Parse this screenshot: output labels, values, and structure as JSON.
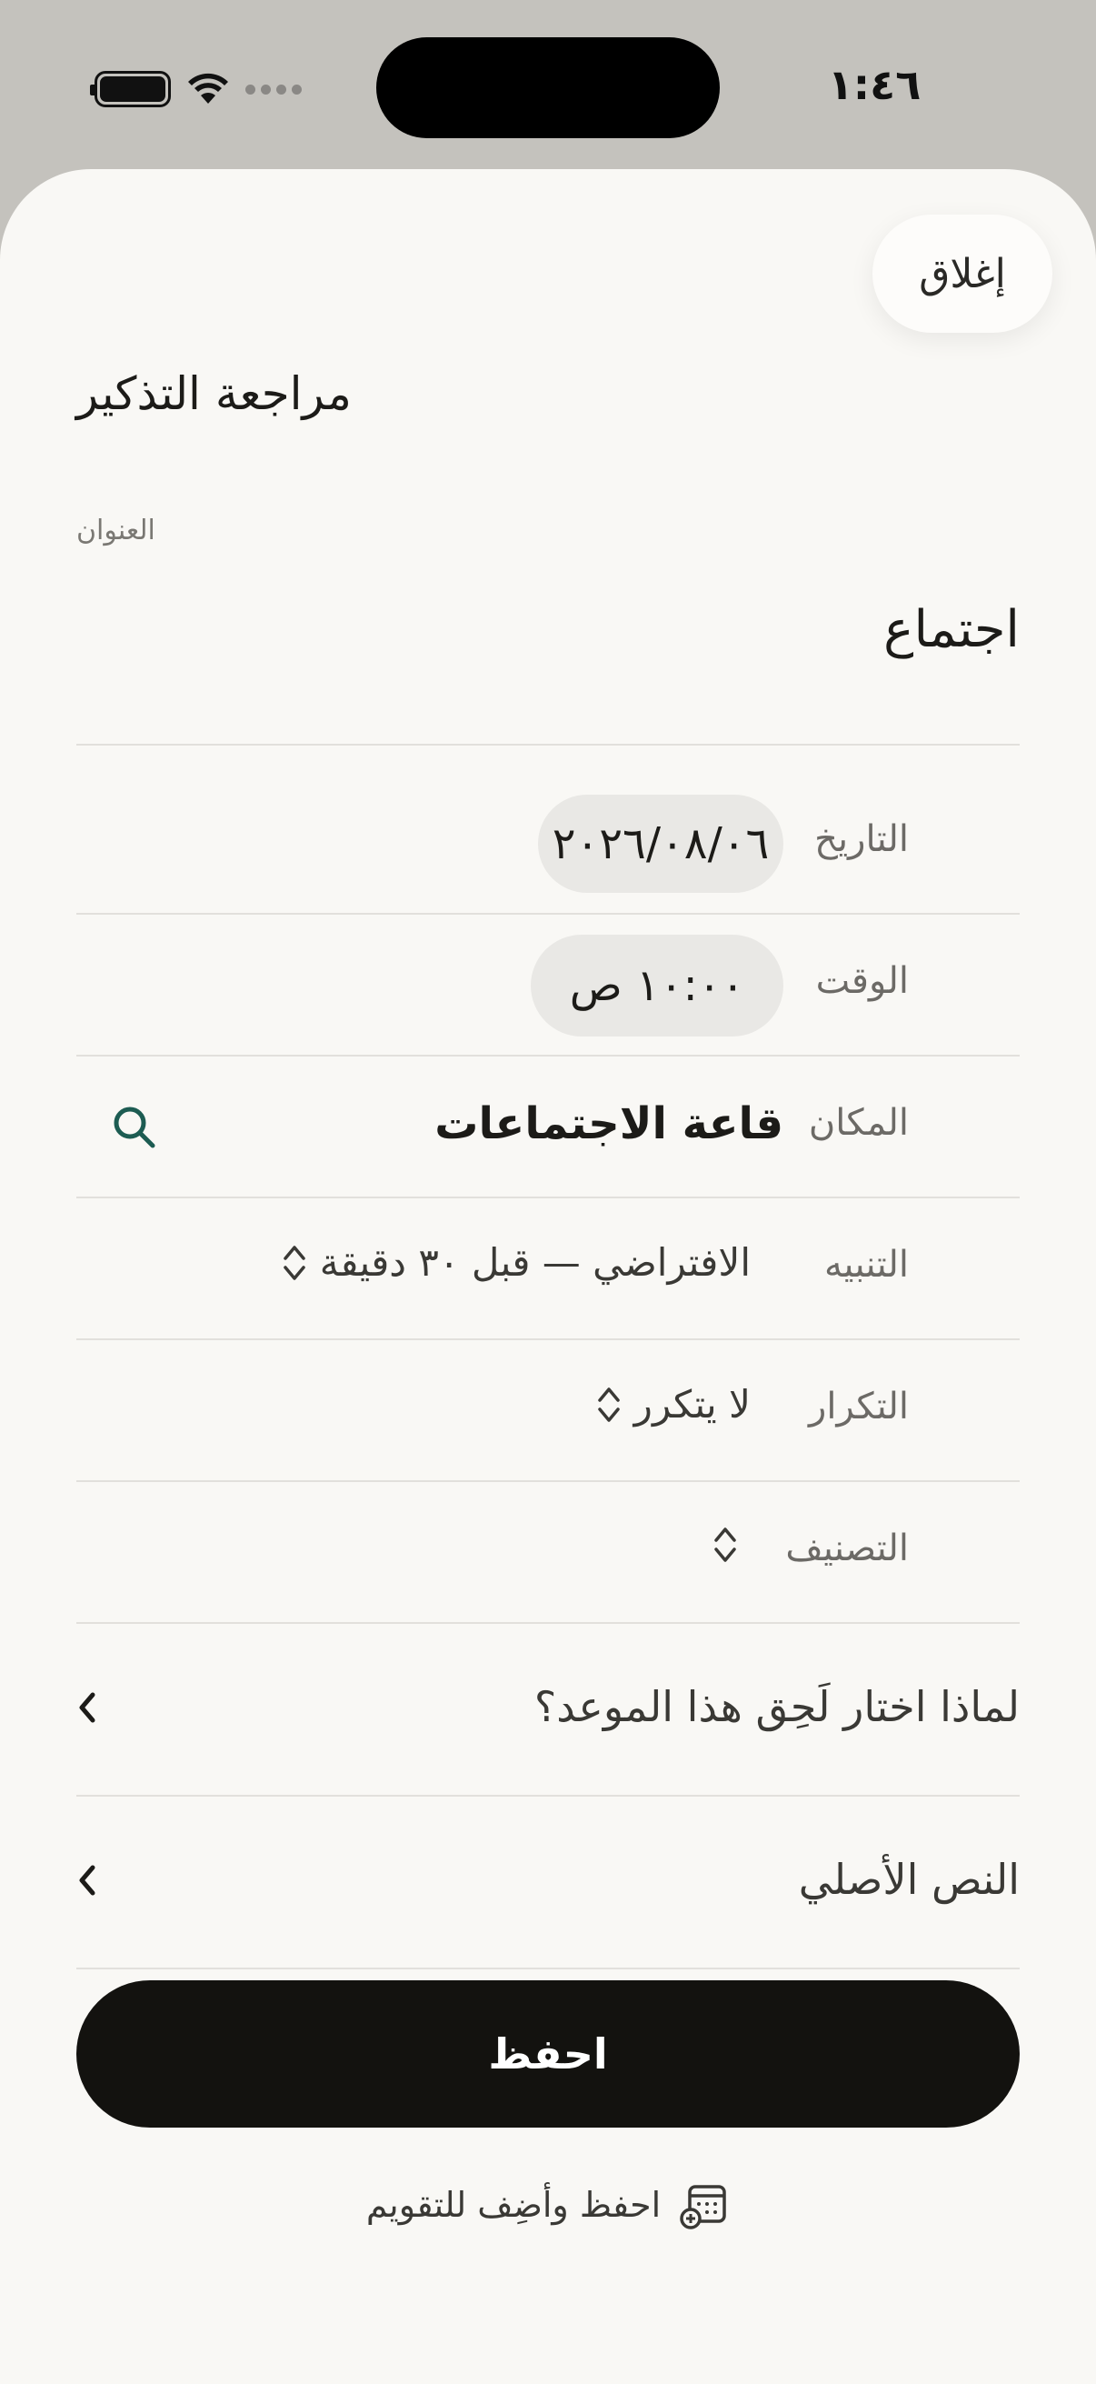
{
  "status_bar": {
    "time": "١:٤٦"
  },
  "sheet": {
    "close_label": "إغلاق",
    "title": "مراجعة التذكير",
    "title_field": {
      "caption": "العنوان",
      "value": "اجتماع"
    },
    "rows": {
      "date": {
        "label": "التاريخ",
        "value": "٢٠٢٦/٠٨/٠٦"
      },
      "time": {
        "label": "الوقت",
        "value": "١٠:٠٠ ص"
      },
      "place": {
        "label": "المكان",
        "value": "قاعة الاجتماعات",
        "action_icon": "search-icon"
      },
      "alert": {
        "label": "التنبيه",
        "value": "الافتراضي — قبل ٣٠ دقيقة",
        "icon": "chevron-up-down-icon"
      },
      "repeat": {
        "label": "التكرار",
        "value": "لا يتكرر",
        "icon": "chevron-up-down-icon"
      },
      "category": {
        "label": "التصنيف",
        "value": "",
        "icon": "chevron-up-down-icon"
      }
    },
    "expandables": [
      {
        "label": "لماذا اختار لَحِق هذا الموعد؟",
        "icon": "chevron-left-icon"
      },
      {
        "label": "النص الأصلي",
        "icon": "chevron-left-icon"
      }
    ],
    "save_label": "احفظ",
    "save_and_add_label": "احفظ وأضِف للتقويم",
    "save_and_add_icon": "calendar-add-icon"
  },
  "colors": {
    "background_gray": "#c4c2bd",
    "sheet": "#f9f8f5",
    "pill": "#e9e8e5",
    "primary_button": "#13120f",
    "search_icon": "#1d5c52"
  }
}
